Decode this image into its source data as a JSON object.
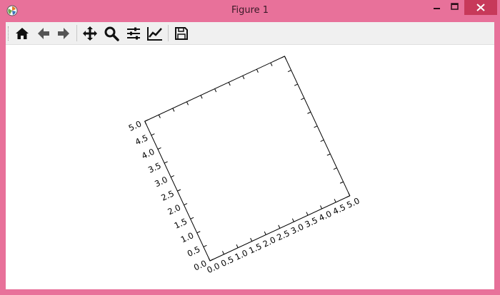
{
  "window": {
    "title": "Figure 1"
  },
  "toolbar": {
    "items": [
      {
        "name": "home-button",
        "icon": "home-icon"
      },
      {
        "name": "back-button",
        "icon": "arrow-left-icon"
      },
      {
        "name": "forward-button",
        "icon": "arrow-right-icon"
      },
      {
        "name": "pan-button",
        "icon": "move-icon"
      },
      {
        "name": "zoom-button",
        "icon": "magnifier-icon"
      },
      {
        "name": "subplots-button",
        "icon": "sliders-icon"
      },
      {
        "name": "edit-axis-button",
        "icon": "line-chart-icon"
      },
      {
        "name": "save-button",
        "icon": "floppy-disk-icon"
      }
    ]
  },
  "chart_data": {
    "type": "line",
    "title": "",
    "xlabel": "",
    "ylabel": "",
    "xlim": [
      0.0,
      5.0
    ],
    "ylim": [
      0.0,
      5.0
    ],
    "x_ticks": [
      "0.0",
      "0.5",
      "1.0",
      "1.5",
      "2.0",
      "2.5",
      "3.0",
      "3.5",
      "4.0",
      "4.5",
      "5.0"
    ],
    "y_ticks": [
      "0.0",
      "0.5",
      "1.0",
      "1.5",
      "2.0",
      "2.5",
      "3.0",
      "3.5",
      "4.0",
      "4.5",
      "5.0"
    ],
    "series": [],
    "rotation_degrees": 25,
    "grid": false
  },
  "colors": {
    "frame": "#e8719a",
    "close_button": "#c7395a",
    "axes": "#000000",
    "canvas": "#ffffff"
  }
}
